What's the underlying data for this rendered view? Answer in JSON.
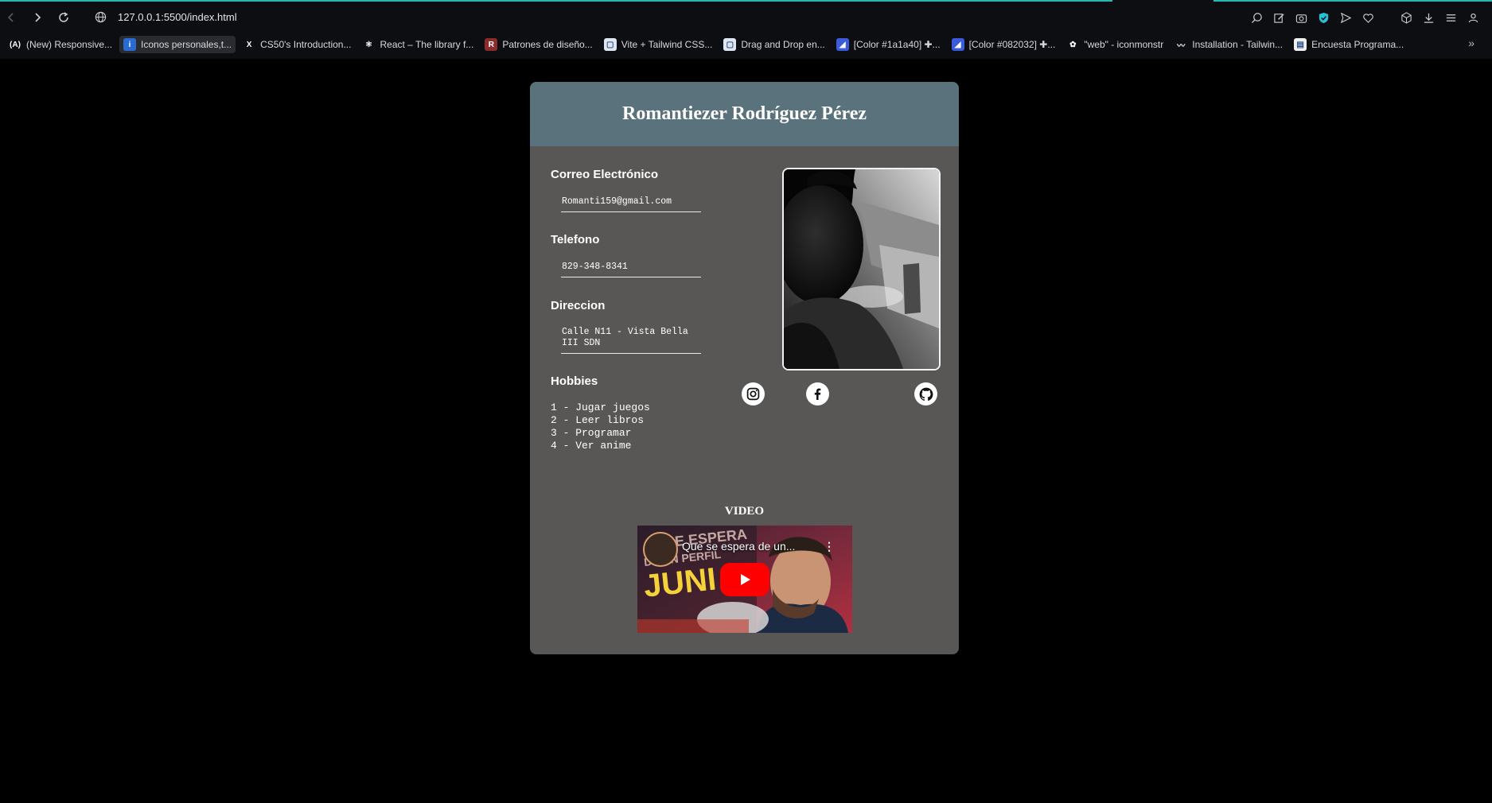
{
  "browser": {
    "url": "127.0.0.1:5500/index.html",
    "bookmarks": [
      {
        "label": "(New) Responsive...",
        "icon": "acc-icon",
        "color": "#0d0e12",
        "glyph": "(A)"
      },
      {
        "label": "Iconos personales,t...",
        "icon": "iconify-icon",
        "color": "#2a6bd1",
        "glyph": "i"
      },
      {
        "label": "CS50's Introduction...",
        "icon": "x-icon",
        "color": "#0d0e12",
        "glyph": "X"
      },
      {
        "label": "React – The library f...",
        "icon": "react-icon",
        "color": "#0d0e12",
        "glyph": "⚛"
      },
      {
        "label": "Patrones de diseño...",
        "icon": "refactoring-icon",
        "color": "#8a2c2c",
        "glyph": "R"
      },
      {
        "label": "Vite + Tailwind CSS...",
        "icon": "page-icon",
        "color": "#dfe6ef",
        "glyph": "▢"
      },
      {
        "label": "Drag and Drop en...",
        "icon": "page-icon",
        "color": "#dfe6ef",
        "glyph": "▢"
      },
      {
        "label": "[Color #1a1a40] ✚...",
        "icon": "color-icon",
        "color": "#3b5bdb",
        "glyph": "◢"
      },
      {
        "label": "[Color #082032] ✚...",
        "icon": "color-icon",
        "color": "#3b5bdb",
        "glyph": "◢"
      },
      {
        "label": "\"web\" - iconmonstr",
        "icon": "iconmonstr-icon",
        "color": "#0d0e12",
        "glyph": "✿"
      },
      {
        "label": "Installation - Tailwin...",
        "icon": "tailwind-icon",
        "color": "#0d0e12",
        "glyph": "〰"
      },
      {
        "label": "Encuesta Programa...",
        "icon": "document-icon",
        "color": "#f0f0f0",
        "glyph": "▤"
      }
    ]
  },
  "page": {
    "name": "Romantiezer Rodríguez Pérez",
    "email_label": "Correo Electrónico",
    "email": "Romanti159@gmail.com",
    "phone_label": "Telefono",
    "phone": "829-348-8341",
    "address_label": "Direccion",
    "address": "Calle N11 - Vista Bella III SDN",
    "hobbies_label": "Hobbies",
    "hobbies": [
      "1 - Jugar juegos",
      "2 - Leer libros",
      "3 - Programar",
      "4 - Ver anime"
    ],
    "video_label": "VIDEO",
    "video_title": "Que se espera de un...",
    "thumbnail_text_1": "SE ESPERA",
    "thumbnail_text_2": "DE UN PERFIL",
    "thumbnail_text_3": "JUNI"
  },
  "colors": {
    "card": "#585756",
    "header": "#5a727c",
    "background": "#000000"
  }
}
